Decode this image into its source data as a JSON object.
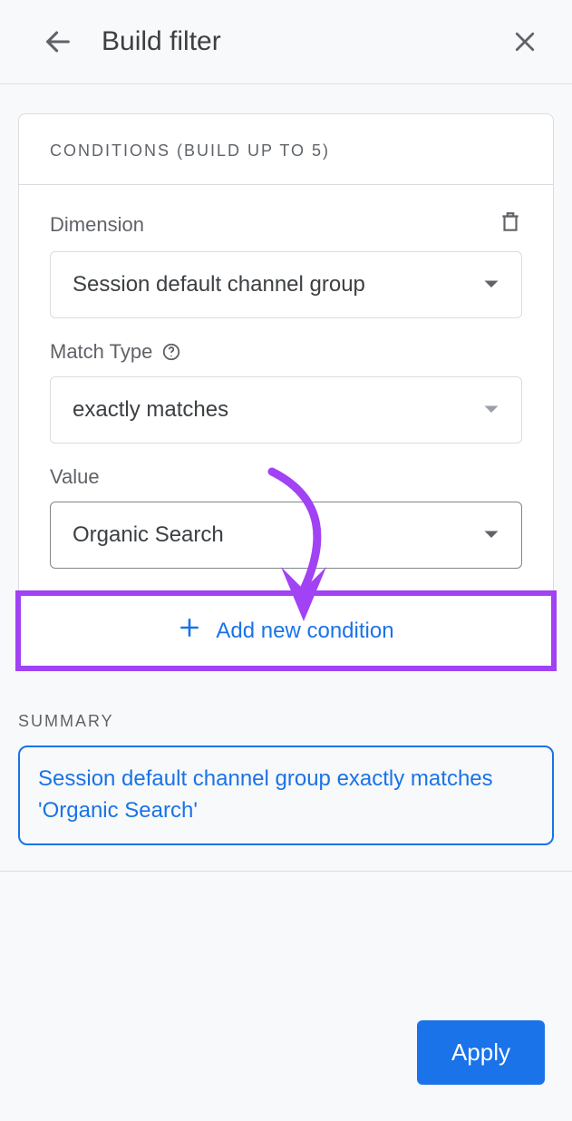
{
  "header": {
    "title": "Build filter"
  },
  "conditions": {
    "header": "CONDITIONS (BUILD UP TO 5)",
    "dimension_label": "Dimension",
    "dimension_value": "Session default channel group",
    "match_label": "Match Type",
    "match_value": "exactly matches",
    "value_label": "Value",
    "value_value": "Organic Search",
    "add_label": "Add new condition"
  },
  "summary": {
    "label": "SUMMARY",
    "text": "Session default channel group exactly matches 'Organic Search'"
  },
  "footer": {
    "apply": "Apply"
  },
  "colors": {
    "accent": "#1a73e8",
    "highlight": "#a142f4"
  }
}
